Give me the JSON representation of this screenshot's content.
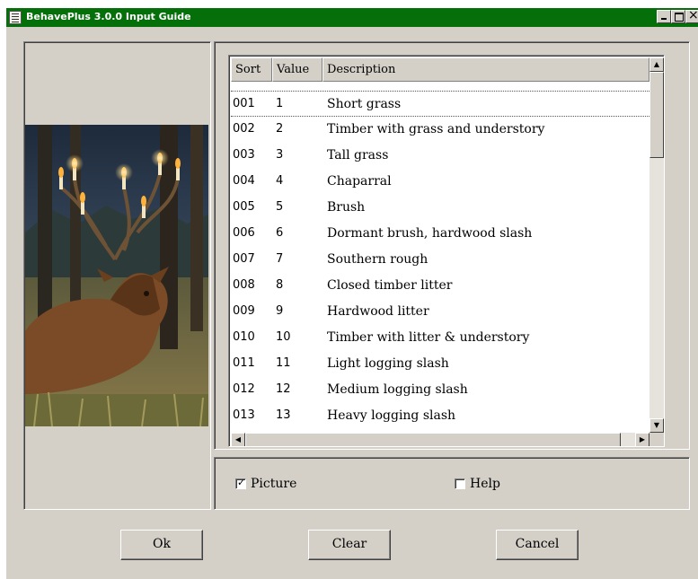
{
  "window": {
    "title": "BehavePlus 3.0.0 Input Guide"
  },
  "table": {
    "headers": {
      "sort": "Sort",
      "value": "Value",
      "description": "Description"
    },
    "rows": [
      {
        "sort": "001",
        "value": "1",
        "description": "Short grass"
      },
      {
        "sort": "002",
        "value": "2",
        "description": "Timber with grass and understory"
      },
      {
        "sort": "003",
        "value": "3",
        "description": "Tall grass"
      },
      {
        "sort": "004",
        "value": "4",
        "description": "Chaparral"
      },
      {
        "sort": "005",
        "value": "5",
        "description": "Brush"
      },
      {
        "sort": "006",
        "value": "6",
        "description": "Dormant brush, hardwood slash"
      },
      {
        "sort": "007",
        "value": "7",
        "description": "Southern rough"
      },
      {
        "sort": "008",
        "value": "8",
        "description": "Closed timber litter"
      },
      {
        "sort": "009",
        "value": "9",
        "description": "Hardwood litter"
      },
      {
        "sort": "010",
        "value": "10",
        "description": "Timber with litter & understory"
      },
      {
        "sort": "011",
        "value": "11",
        "description": "Light logging slash"
      },
      {
        "sort": "012",
        "value": "12",
        "description": "Medium logging slash"
      },
      {
        "sort": "013",
        "value": "13",
        "description": "Heavy logging slash"
      }
    ]
  },
  "options": {
    "picture_label": "Picture",
    "picture_checked": true,
    "help_label": "Help",
    "help_checked": false
  },
  "buttons": {
    "ok": "Ok",
    "clear": "Clear",
    "cancel": "Cancel"
  },
  "colors": {
    "titlebar": "#05700a",
    "face": "#d4d0c8"
  }
}
